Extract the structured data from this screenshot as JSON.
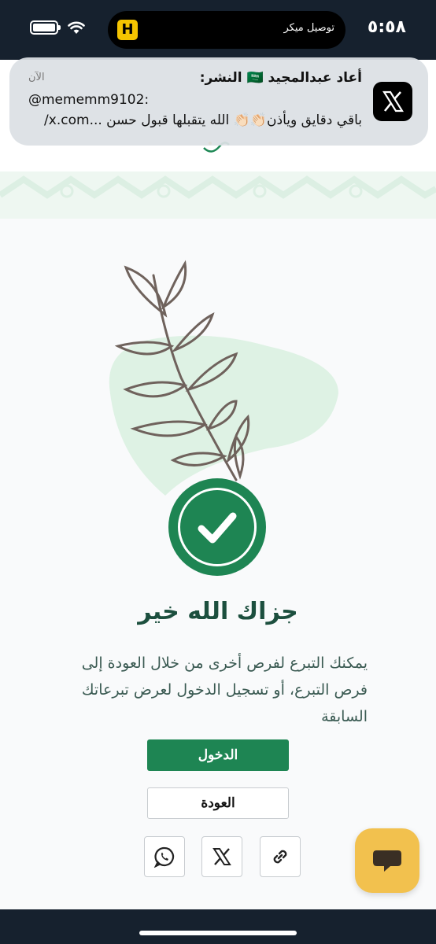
{
  "status_bar": {
    "time": "٥:٥٨",
    "island_app_letter": "H",
    "island_text": "توصيل ميكر"
  },
  "notification": {
    "title": "أعاد عبدالمجيد 🇸🇦 النشر:",
    "time": "الآن",
    "handle": "@mememm9102:",
    "body": "باقي دقايق ويأذن👏🏻👏🏻 الله يتقبلها قبول حسن ...x.com/"
  },
  "main": {
    "title": "جزاك الله خير",
    "description": "يمكنك التبرع لفرص أخرى من خلال العودة إلى فرص التبرع، أو تسجيل الدخول لعرض تبرعاتك السابقة",
    "login_button": "الدخول",
    "back_button": "العودة"
  },
  "share": [
    "link-icon",
    "x-icon",
    "whatsapp-icon"
  ],
  "colors": {
    "primary": "#1e8553",
    "dark_bar": "#16212e",
    "chat_fab": "#f2c14e"
  }
}
